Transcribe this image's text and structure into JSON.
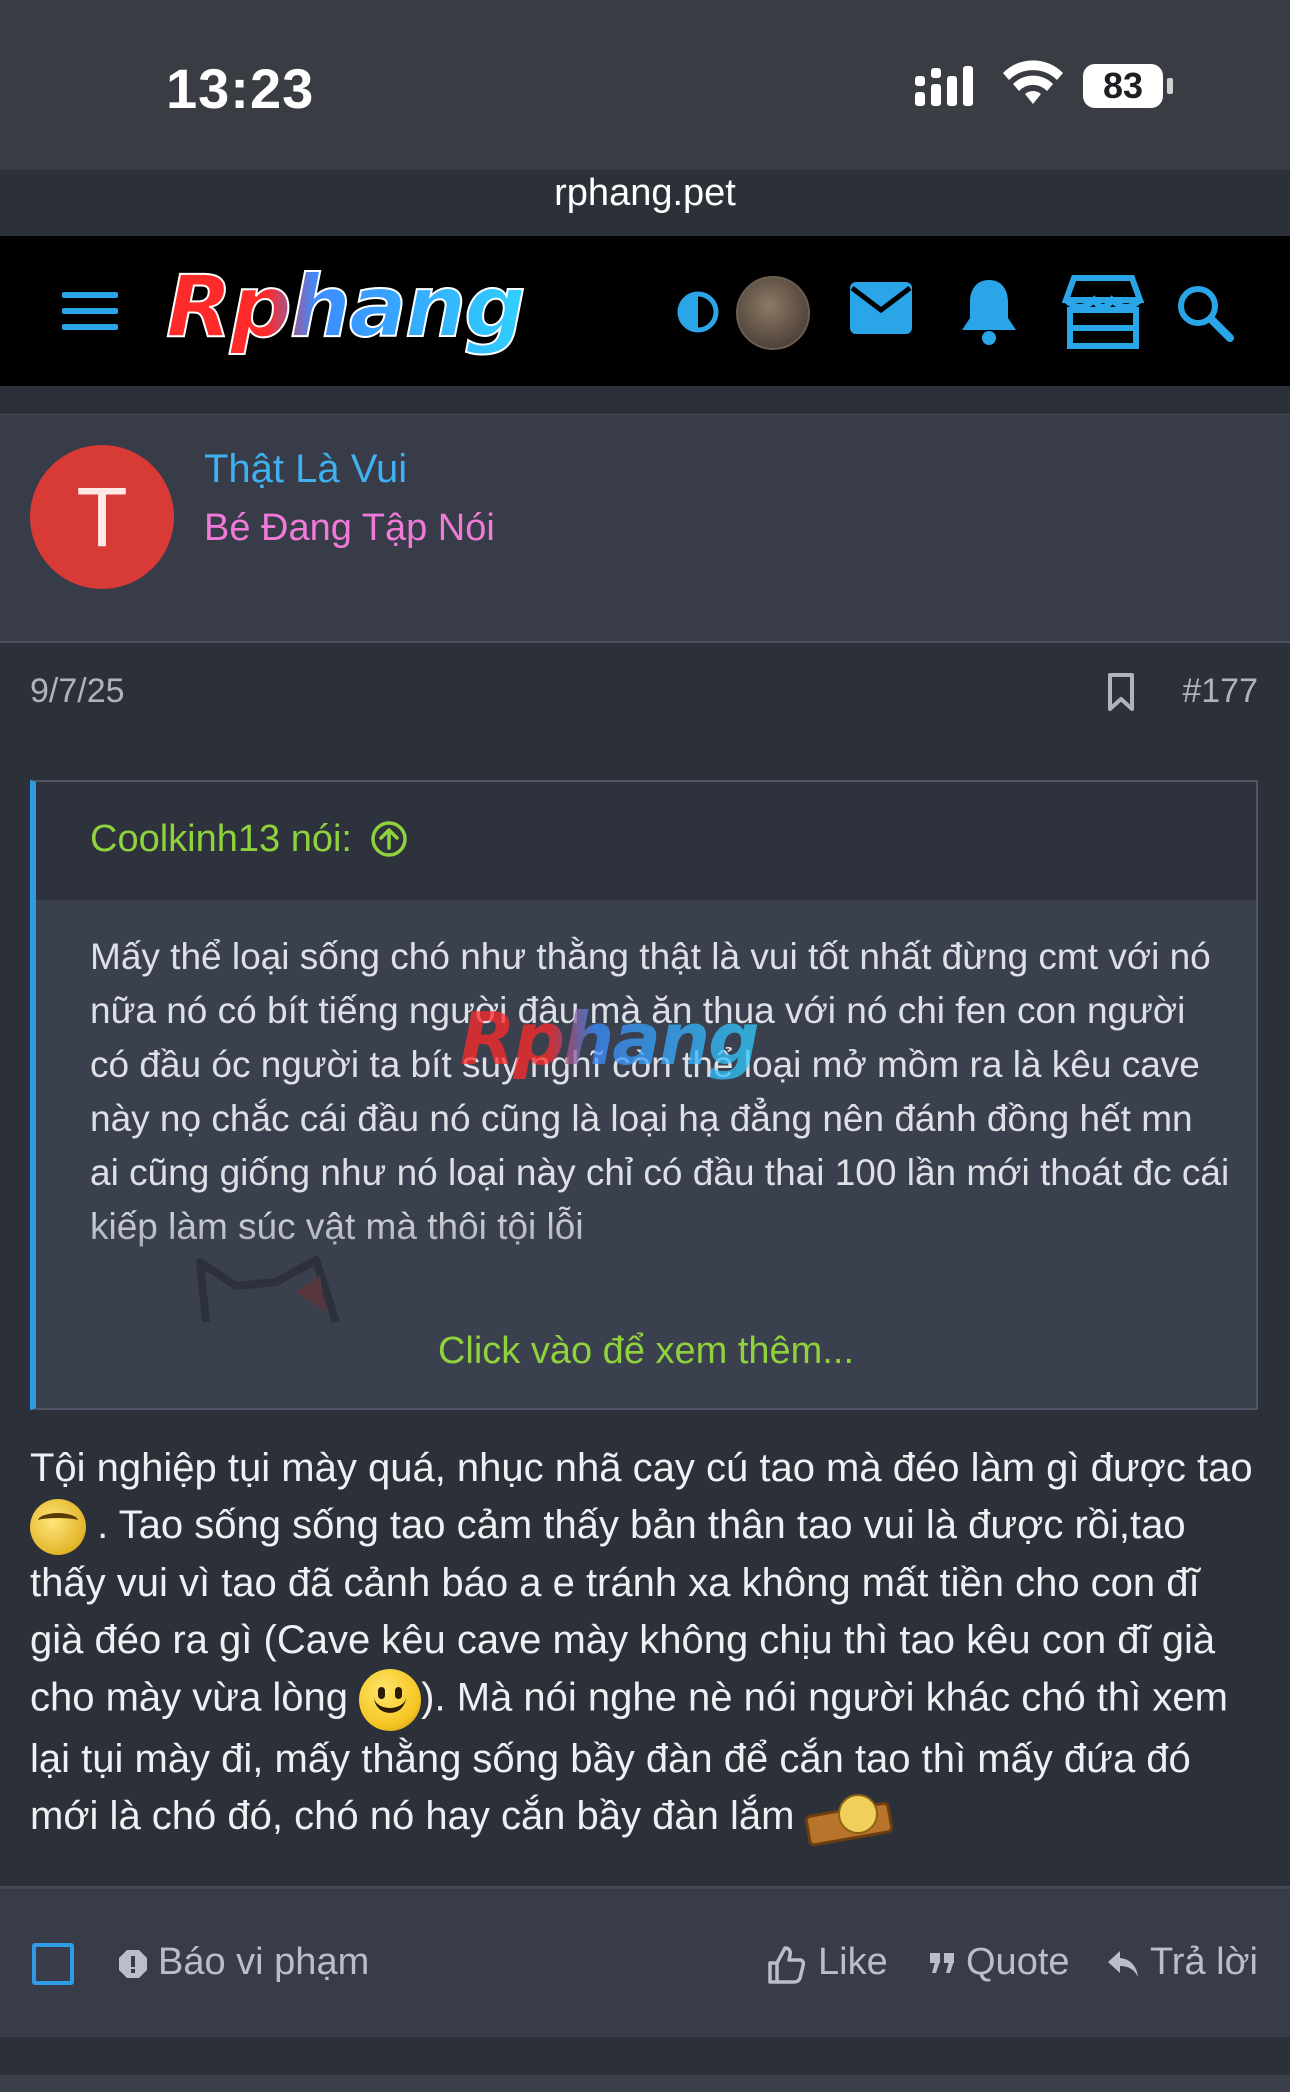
{
  "status_bar": {
    "time": "13:23",
    "battery": "83"
  },
  "browser": {
    "url": "rphang.pet"
  },
  "site": {
    "logo_text": "Rphang"
  },
  "post": {
    "author_initial": "T",
    "author_name": "Thật Là Vui",
    "author_title": "Bé Đang Tập Nói",
    "date": "9/7/25",
    "number": "#177",
    "quote": {
      "author": "Coolkinh13 nói:",
      "text": "Mấy thể loại sống chó như thằng thật là vui tốt nhất đừng cmt với nó nữa nó có bít tiếng người đâu mà ăn thua với nó chi fen con người có đầu óc người ta bít suy nghĩ còn thể loại mở mồm ra là kêu cave này nọ chắc cái đầu nó cũng là loại hạ đẳng nên đánh đồng hết mn ai cũng giống như nó loại này chỉ có đầu thai 100 lần mới thoát đc cái kiếp làm súc vật mà thôi tội lỗi",
      "expand": "Click vào để xem thêm..."
    },
    "body": {
      "part1": "Tội nghiệp tụi mày quá, nhục nhã cay cú tao mà đéo làm gì được tao ",
      "part2": " . Tao sống sống tao cảm thấy bản thân tao vui là được rồi,tao thấy vui vì tao đã cảnh báo a e tránh xa không mất tiền cho con đĩ già đéo ra gì (Cave kêu cave mày không chịu thì tao kêu con đĩ già cho mày vừa lòng ",
      "part3": "). Mà nói nghe nè nói người khác chó thì xem lại tụi mày đi, mấy thằng sống bầy đàn để cắn tao thì mấy đứa đó mới là chó đó, chó nó hay cắn bầy đàn lắm "
    },
    "actions": {
      "report": "Báo vi phạm",
      "like": "Like",
      "quote": "Quote",
      "reply": "Trả lời"
    }
  },
  "colors": {
    "accent_blue": "#2e9be6",
    "username": "#3fb0f0",
    "user_title": "#f07ad8",
    "quote_author": "#8fd23c",
    "avatar_bg": "#d83a36"
  },
  "icons": [
    "menu-icon",
    "contrast-icon",
    "mail-icon",
    "bell-icon",
    "store-icon",
    "search-icon",
    "bookmark-icon",
    "arrow-up-circle-icon",
    "report-icon",
    "like-icon",
    "quote-icon",
    "reply-icon"
  ]
}
